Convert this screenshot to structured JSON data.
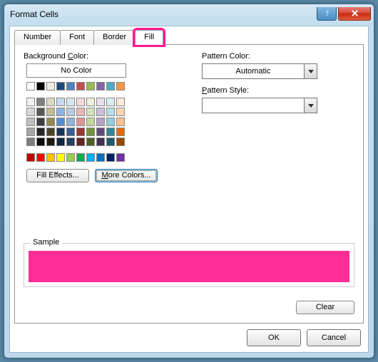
{
  "window": {
    "title": "Format Cells"
  },
  "tabs": [
    "Number",
    "Font",
    "Border",
    "Fill"
  ],
  "active_tab": 3,
  "left": {
    "bg_label": "Background Color:",
    "bg_underline": "C",
    "no_color": "No Color",
    "fill_effects": "Fill Effects...",
    "fill_effects_u": "I",
    "more_colors": "More Colors...",
    "more_colors_u": "M"
  },
  "right": {
    "pattern_color_label": "Pattern Color:",
    "pattern_color_u": "A",
    "pattern_color_value": "Automatic",
    "pattern_style_label": "Pattern Style:",
    "pattern_style_u": "P",
    "pattern_style_value": ""
  },
  "sample_label": "Sample",
  "sample_color": "#ff2e96",
  "clear": "Clear",
  "clear_u": "R",
  "ok": "OK",
  "cancel": "Cancel",
  "palette": {
    "top_row": [
      "#ffffff",
      "#000000",
      "#eeece1",
      "#1f497d",
      "#4f81bd",
      "#c0504d",
      "#9bbb59",
      "#8064a2",
      "#4bacc6",
      "#f79646"
    ],
    "theme_tints": [
      [
        "#f2f2f2",
        "#7f7f7f",
        "#ddd9c3",
        "#c6d9f0",
        "#dbe5f1",
        "#f2dcdb",
        "#ebf1dd",
        "#e5e0ec",
        "#dbeef3",
        "#fdeada"
      ],
      [
        "#d8d8d8",
        "#595959",
        "#c4bd97",
        "#8db3e2",
        "#b8cce4",
        "#e5b9b7",
        "#d7e3bc",
        "#ccc1d9",
        "#b7dde8",
        "#fbd5b5"
      ],
      [
        "#bfbfbf",
        "#3f3f3f",
        "#938953",
        "#548dd4",
        "#95b3d7",
        "#d99694",
        "#c3d69b",
        "#b2a2c7",
        "#92cddc",
        "#fac08f"
      ],
      [
        "#a5a5a5",
        "#262626",
        "#494429",
        "#17365d",
        "#366092",
        "#953734",
        "#76923c",
        "#5f497a",
        "#31859b",
        "#e36c09"
      ],
      [
        "#7f7f7f",
        "#0c0c0c",
        "#1d1b10",
        "#0f243e",
        "#244061",
        "#632423",
        "#4f6128",
        "#3f3151",
        "#205867",
        "#974806"
      ]
    ],
    "standard": [
      "#c00000",
      "#ff0000",
      "#ffc000",
      "#ffff00",
      "#92d050",
      "#00b050",
      "#00b0f0",
      "#0070c0",
      "#002060",
      "#7030a0"
    ]
  }
}
